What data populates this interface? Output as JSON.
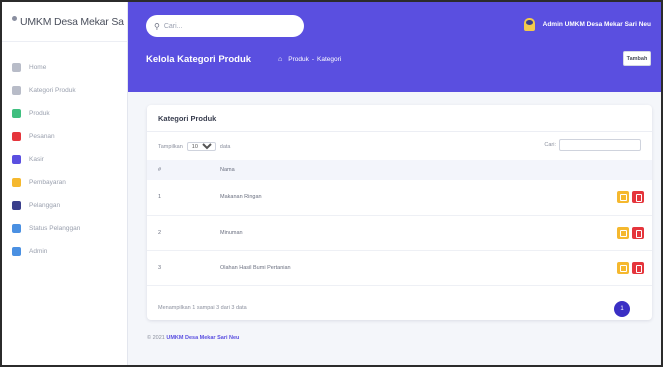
{
  "sidebar": {
    "brand": "UMKM Desa Mekar Sa",
    "items": [
      {
        "label": "Home",
        "icon": "home-icon",
        "color": "#b8bcc8",
        "w": 26
      },
      {
        "label": "Kategori Produk",
        "icon": "tag-icon",
        "color": "#b8bcc8",
        "w": 44
      },
      {
        "label": "Produk",
        "icon": "box-icon",
        "color": "#3fbf7f",
        "w": 24
      },
      {
        "label": "Pesanan",
        "icon": "cart-icon",
        "color": "#e5353c",
        "w": 28
      },
      {
        "label": "Kasir",
        "icon": "cash-register-icon",
        "color": "#5a4fe0",
        "w": 22
      },
      {
        "label": "Pembayaran",
        "icon": "money-icon",
        "color": "#f5b82e",
        "w": 36
      },
      {
        "label": "Pelanggan",
        "icon": "users-icon",
        "color": "#3a3f8c",
        "w": 32
      },
      {
        "label": "Status Pelanggan",
        "icon": "user-check-icon",
        "color": "#4a90e2",
        "w": 46
      },
      {
        "label": "Admin",
        "icon": "user-icon",
        "color": "#4a90e2",
        "w": 22
      }
    ]
  },
  "topbar": {
    "search_placeholder": "Cari...",
    "user_name": "Admin UMKM Desa Mekar Sari Neu",
    "page_title": "Kelola Kategori Produk",
    "breadcrumb": [
      "Produk",
      "Kategori"
    ],
    "button_label": "Tambah"
  },
  "card": {
    "title": "Kategori Produk",
    "show_prefix": "Tampilkan",
    "show_value": "10",
    "show_suffix": "data",
    "search_label": "Cari:",
    "columns": [
      "#",
      "Nama"
    ],
    "rows": [
      {
        "no": "1",
        "nama": "Makanan Ringan"
      },
      {
        "no": "2",
        "nama": "Minuman"
      },
      {
        "no": "3",
        "nama": "Olahan Hasil Bumi Pertanian"
      }
    ],
    "info": "Menampilkan 1 sampai 3 dari 3 data",
    "page": "1"
  },
  "footer": {
    "prefix": "© 2021",
    "brand": "UMKM Desa Mekar Sari Neu"
  },
  "colors": {
    "primary": "#5a4fe0",
    "edit": "#f5b82e",
    "delete": "#e5353c"
  }
}
